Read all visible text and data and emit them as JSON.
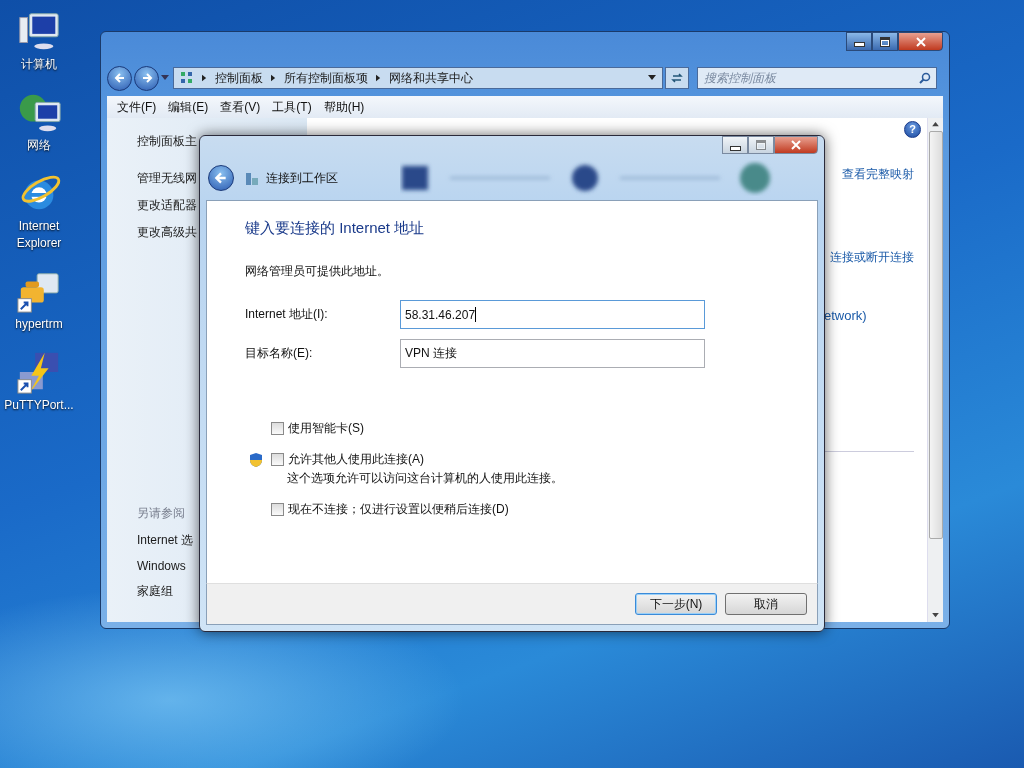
{
  "desktop_icons": [
    {
      "label": "计算机",
      "kind": "computer",
      "shortcut": false
    },
    {
      "label": "网络",
      "kind": "network",
      "shortcut": false
    },
    {
      "label": "Internet Explorer",
      "kind": "browser",
      "shortcut": false
    },
    {
      "label": "hypertrm",
      "kind": "phone",
      "shortcut": true
    },
    {
      "label": "PuTTYPort...",
      "kind": "putty",
      "shortcut": true
    }
  ],
  "explorer": {
    "breadcrumb": [
      "控制面板",
      "所有控制面板项",
      "网络和共享中心"
    ],
    "search": {
      "placeholder": "搜索控制面板"
    },
    "menu": [
      "文件(F)",
      "编辑(E)",
      "查看(V)",
      "工具(T)",
      "帮助(H)"
    ],
    "sidebar": {
      "links": [
        "控制面板主",
        "管理无线网",
        "更改适配器",
        "更改高级共"
      ],
      "see_also_title": "另请参阅",
      "see_also": [
        "Internet 选",
        "Windows",
        "家庭组"
      ]
    },
    "help": "?",
    "content_links": [
      "查看完整映射",
      "连接或断开连接",
      "etwork)"
    ]
  },
  "dialog": {
    "title": "连接到工作区",
    "heading": "键入要连接的 Internet 地址",
    "intro": "网络管理员可提供此地址。",
    "fields": [
      {
        "label": "Internet 地址(I):",
        "value": "58.31.46.207",
        "focused": true
      },
      {
        "label": "目标名称(E):",
        "value": "VPN 连接",
        "focused": false
      }
    ],
    "options": [
      {
        "label": "使用智能卡(S)",
        "checked": false,
        "shield": false
      },
      {
        "label": "允许其他人使用此连接(A)",
        "checked": false,
        "shield": true,
        "description": "这个选项允许可以访问这台计算机的人使用此连接。"
      },
      {
        "label": "现在不连接；仅进行设置以便稍后连接(D)",
        "checked": false,
        "shield": false
      }
    ],
    "buttons": [
      {
        "label": "下一步(N)",
        "default": true
      },
      {
        "label": "取消",
        "default": false
      }
    ]
  }
}
